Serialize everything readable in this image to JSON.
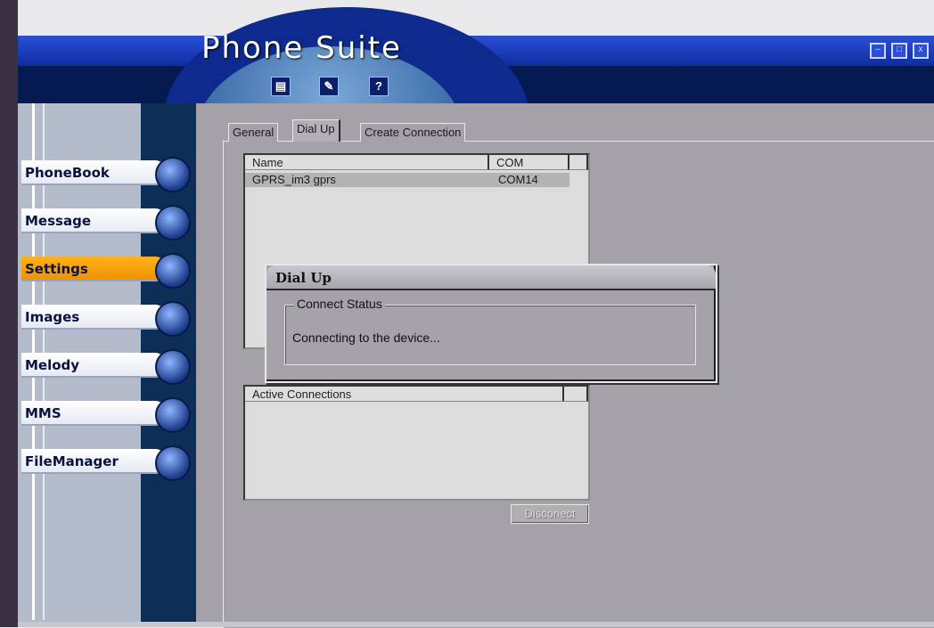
{
  "app": {
    "title": "Phone Suite"
  },
  "toolbar": [
    {
      "icon": "document-icon",
      "glyph": "▤"
    },
    {
      "icon": "edit-icon",
      "glyph": "✎"
    },
    {
      "icon": "help-icon",
      "glyph": "?"
    }
  ],
  "window_controls": {
    "minimize": "–",
    "maximize": "□",
    "close": "x"
  },
  "nav": [
    {
      "label": "PhoneBook",
      "icon": "phone-icon",
      "active": false
    },
    {
      "label": "Message",
      "icon": "envelope-icon",
      "active": false
    },
    {
      "label": "Settings",
      "icon": "settings-icon",
      "active": true
    },
    {
      "label": "Images",
      "icon": "images-icon",
      "active": false
    },
    {
      "label": "Melody",
      "icon": "guitar-icon",
      "active": false
    },
    {
      "label": "MMS",
      "icon": "balloon-icon",
      "active": false
    },
    {
      "label": "FileManager",
      "icon": "file-cabinet-icon",
      "active": false
    }
  ],
  "tabs": [
    {
      "label": "General",
      "active": false
    },
    {
      "label": "Dial Up",
      "active": true
    },
    {
      "label": "Create Connection",
      "active": false
    }
  ],
  "connections_list": {
    "columns": [
      "Name",
      "COM"
    ],
    "rows": [
      {
        "name": "GPRS_im3 gprs",
        "com": "COM14"
      }
    ]
  },
  "active_connections": {
    "columns": [
      "Active Connections"
    ]
  },
  "disconnect_button": "Disconect",
  "dialog": {
    "title": "Dial Up",
    "group_title": "Connect Status",
    "status_text": "Connecting to the device..."
  },
  "colors": {
    "accent": "#1a3bb8",
    "active_nav": "#f2a000",
    "panel": "#a4a1a9"
  }
}
